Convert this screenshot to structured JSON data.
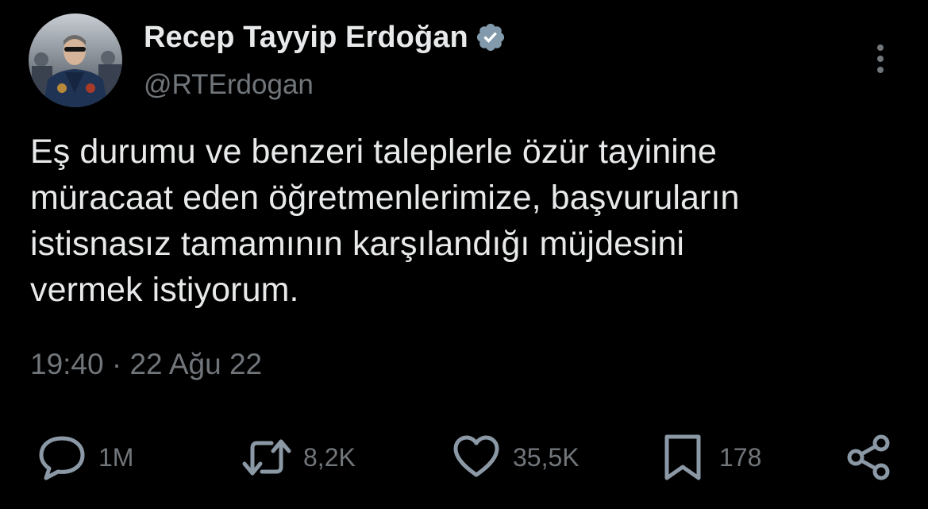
{
  "author": {
    "display_name": "Recep Tayyip Erdoğan",
    "handle": "@RTErdogan",
    "verified": true
  },
  "tweet": {
    "lines": [
      "Eş durumu ve benzeri taleplerle özür tayinine",
      "müracaat eden öğretmenlerimize, başvuruların",
      "istisnasız tamamının karşılandığı müjdesini",
      "vermek istiyorum."
    ],
    "timestamp": "19:40 · 22 Ağu 22"
  },
  "actions": {
    "views": "1M",
    "retweets": "8,2K",
    "likes": "35,5K",
    "bookmarks": "178"
  },
  "icons": [
    "more-vertical-icon",
    "verified-badge-icon",
    "views-icon",
    "retweet-icon",
    "like-icon",
    "bookmark-icon",
    "share-icon"
  ],
  "colors": {
    "background": "#000000",
    "primary_text": "#e7e9ea",
    "secondary_text": "#71767b",
    "icon": "#8b98a5",
    "verified_badge": "#829aab"
  }
}
